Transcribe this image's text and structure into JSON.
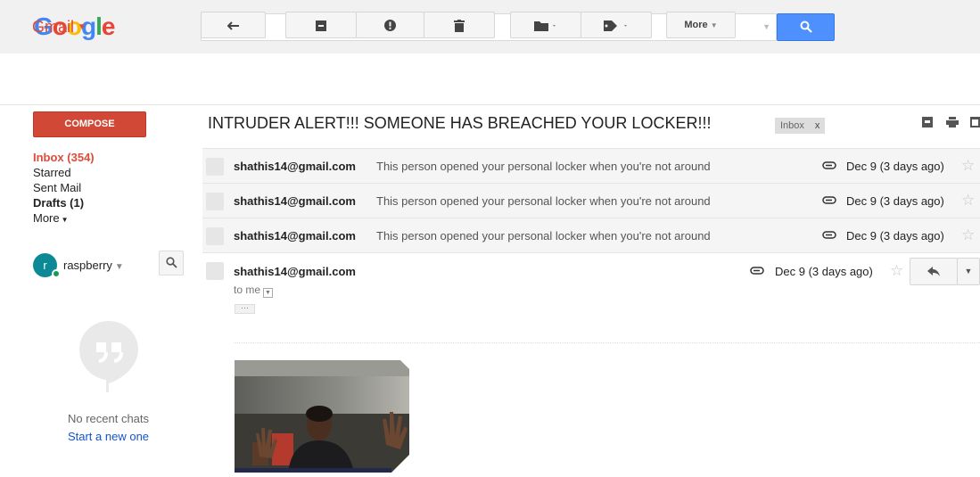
{
  "header": {
    "logo_letters": [
      "G",
      "o",
      "o",
      "g",
      "l",
      "e"
    ],
    "logo_colors": [
      "#4285f4",
      "#ea4335",
      "#fbbc05",
      "#4285f4",
      "#34a853",
      "#ea4335"
    ],
    "search_value": "",
    "search_icon": "search-icon"
  },
  "toolbar": {
    "app_label": "Gmail",
    "more_label": "More",
    "buttons": [
      "back-arrow-icon",
      "archive-icon",
      "report-spam-icon",
      "delete-icon",
      "move-to-folder-icon",
      "labels-icon"
    ]
  },
  "sidebar": {
    "compose_label": "COMPOSE",
    "items": [
      {
        "label": "Inbox (354)"
      },
      {
        "label": "Starred"
      },
      {
        "label": "Sent Mail"
      },
      {
        "label": "Drafts (1)"
      },
      {
        "label": "More"
      }
    ],
    "hangouts": {
      "avatar_letter": "r",
      "user": "raspberry",
      "no_chats": "No recent chats",
      "start_new": "Start a new one"
    }
  },
  "thread": {
    "subject": "INTRUDER ALERT!!! SOMEONE HAS BREACHED YOUR LOCKER!!!",
    "label_chip": "Inbox",
    "label_chip_close": "x",
    "messages": [
      {
        "sender": "shathis14@gmail.com",
        "snippet": "This person opened your personal locker when you're not around",
        "date": "Dec 9 (3 days ago)"
      },
      {
        "sender": "shathis14@gmail.com",
        "snippet": "This person opened your personal locker when you're not around",
        "date": "Dec 9 (3 days ago)"
      },
      {
        "sender": "shathis14@gmail.com",
        "snippet": "This person opened your personal locker when you're not around",
        "date": "Dec 9 (3 days ago)"
      }
    ],
    "expanded": {
      "sender": "shathis14@gmail.com",
      "date": "Dec 9 (3 days ago)",
      "to": "to me",
      "ellipsis": "···"
    }
  },
  "colors": {
    "accent_red": "#dd4b39",
    "compose_red": "#d14836",
    "search_blue": "#4d90fe",
    "link_blue": "#1155cc"
  }
}
